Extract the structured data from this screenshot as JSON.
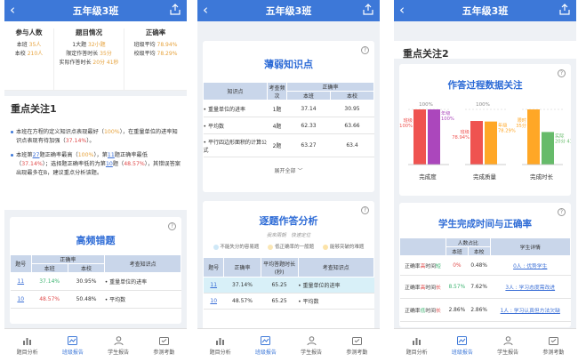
{
  "title": "五年级3班",
  "tabbar": [
    {
      "label": "题目分析",
      "icon": "bar-chart-icon"
    },
    {
      "label": "班级报告",
      "icon": "report-icon"
    },
    {
      "label": "学生报告",
      "icon": "person-icon"
    },
    {
      "label": "参测考勤",
      "icon": "calendar-icon"
    }
  ],
  "screen1": {
    "stats": {
      "participants": {
        "title": "参与人数",
        "class_label": "本班",
        "class_val": "35人",
        "school_label": "本校",
        "school_val": "210人"
      },
      "questions": {
        "title": "题目情况",
        "line1a": "1大题",
        "line1b": "32小题",
        "line2a": "限定作答时长",
        "line2b": "35分",
        "line3a": "实际作答时长",
        "line3b": "20分 41秒"
      },
      "accuracy": {
        "title": "正确率",
        "class_label": "班级平均",
        "class_val": "78.94%",
        "school_label": "校级平均",
        "school_val": "78.29%"
      }
    },
    "focus_title": "重点关注1",
    "b1": {
      "pre": "本班在方程的定义知识点表现最好（",
      "v1": "100%",
      "mid": "），在重量单位的进率知识点表现有待加强（",
      "v2": "37.14%",
      "end": "）。"
    },
    "b2": {
      "p1": "本班第",
      "q1": "27",
      "p2": "题正确率最高（",
      "v1": "100%",
      "p3": "），第",
      "q2": "11",
      "p4": "题正确率最低（",
      "v2": "37.14%",
      "p5": "）；选择题正确率低的为第",
      "q3": "10",
      "p6": "题（",
      "v3": "48.57%",
      "p7": "），其错误答案出现最多在B，建议重点分析该题。"
    },
    "freq_title": "高频错题",
    "table": {
      "h_no": "题号",
      "h_acc": "正确率",
      "h_class": "本班",
      "h_school": "本校",
      "h_kp": "考查知识点",
      "rows": [
        {
          "no": "11",
          "c": "37.14%",
          "s": "30.95%",
          "kp": "重量单位的进率"
        },
        {
          "no": "10",
          "c": "48.57%",
          "s": "50.48%",
          "kp": "平均数"
        }
      ]
    }
  },
  "screen2": {
    "weak_title": "薄弱知识点",
    "table": {
      "h_kp": "知识点",
      "h_freq": "考查频次",
      "h_acc": "正确率",
      "h_class": "本班",
      "h_school": "本校",
      "rows": [
        {
          "kp": "重量单位的进率",
          "f": "1题",
          "c": "37.14",
          "s": "30.95"
        },
        {
          "kp": "平均数",
          "f": "4题",
          "c": "62.33",
          "s": "63.66"
        },
        {
          "kp": "平行四边形面积的计算公式",
          "f": "2题",
          "c": "63.27",
          "s": "63.4"
        }
      ]
    },
    "expand": "展开全部",
    "analysis_title": "逐题作答分析",
    "hint": "我來兩朝　快速定位",
    "legend": [
      {
        "label": "不能失分的容易题",
        "color": "#cfe8f7"
      },
      {
        "label": "低正确率的一般题",
        "color": "#fbe7b5"
      },
      {
        "label": "能够突破的难题",
        "color": "#fce3a8"
      }
    ],
    "table2": {
      "h_no": "题号",
      "h_acc": "正确率",
      "h_time": "平均答题时长(秒)",
      "h_kp": "考查知识点",
      "rows": [
        {
          "no": "11",
          "acc": "37.14%",
          "t": "65.25",
          "kp": "重量单位的进率"
        },
        {
          "no": "10",
          "acc": "48.57%",
          "t": "65.25",
          "kp": "平均数"
        }
      ]
    }
  },
  "screen3": {
    "focus_title": "重点关注2",
    "proc_title": "作答过程数据关注",
    "cols": [
      {
        "label": "完成度",
        "bar1_label": "班级",
        "bar1_val": "100%",
        "bar2_label": "年级",
        "bar2_val": "100%",
        "top": "100%",
        "level1": 1.0,
        "level2": 1.0,
        "c1": "#ef5350",
        "c2": "#ab47bc"
      },
      {
        "label": "完成质量",
        "bar1_label": "班级",
        "bar1_val": "78.94%",
        "bar2_label": "年级",
        "bar2_val": "78.29%",
        "top": "100%",
        "level1": 0.79,
        "level2": 0.78,
        "c1": "#ef5350",
        "c2": "#ffa726"
      },
      {
        "label": "完成时长",
        "bar1_label": "限时",
        "bar1_val": "35分",
        "bar2_label": "实际",
        "bar2_val": "20分 41秒",
        "top": "",
        "level1": 1.0,
        "level2": 0.59,
        "c1": "#ffa726",
        "c2": "#66bb6a"
      }
    ],
    "time_title": "学生完成时间与正确率",
    "table": {
      "h_type": "",
      "h_ratio": "人数占比",
      "h_class": "本班",
      "h_school": "本校",
      "h_detail": "学生详情",
      "rows": [
        {
          "a": "正确率",
          "b": "高",
          "c": "时间",
          "d": "短",
          "cls": "0%",
          "sch": "0.48%",
          "detail": "0人 : 优势学生"
        },
        {
          "a": "正确率",
          "b": "高",
          "c": "时间",
          "d": "长",
          "cls": "8.57%",
          "sch": "7.62%",
          "detail": "3人 : 学习态度需改进"
        },
        {
          "a": "正确率",
          "b": "低",
          "c": "时间",
          "d": "长",
          "cls": "2.86%",
          "sch": "2.86%",
          "detail": "1人 : 学习认真但方法欠缺"
        }
      ]
    }
  }
}
